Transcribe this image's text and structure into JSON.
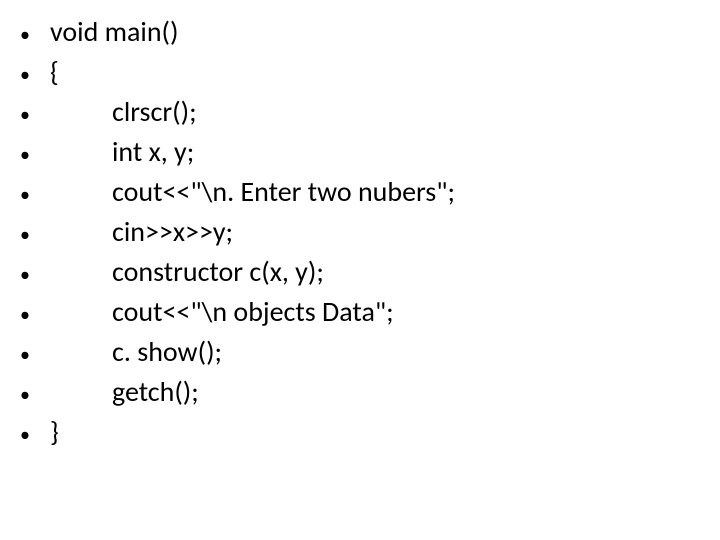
{
  "lines": [
    {
      "text": "void main()",
      "indented": false
    },
    {
      "text": "{",
      "indented": false
    },
    {
      "text": "clrscr();",
      "indented": true
    },
    {
      "text": "int x, y;",
      "indented": true
    },
    {
      "text": "cout<<\"\\n. Enter two nubers\";",
      "indented": true
    },
    {
      "text": "cin>>x>>y;",
      "indented": true
    },
    {
      "text": "constructor c(x, y);",
      "indented": true
    },
    {
      "text": "cout<<\"\\n objects Data\";",
      "indented": true
    },
    {
      "text": "c. show();",
      "indented": true
    },
    {
      "text": "getch();",
      "indented": true
    },
    {
      "text": "}",
      "indented": false
    }
  ]
}
